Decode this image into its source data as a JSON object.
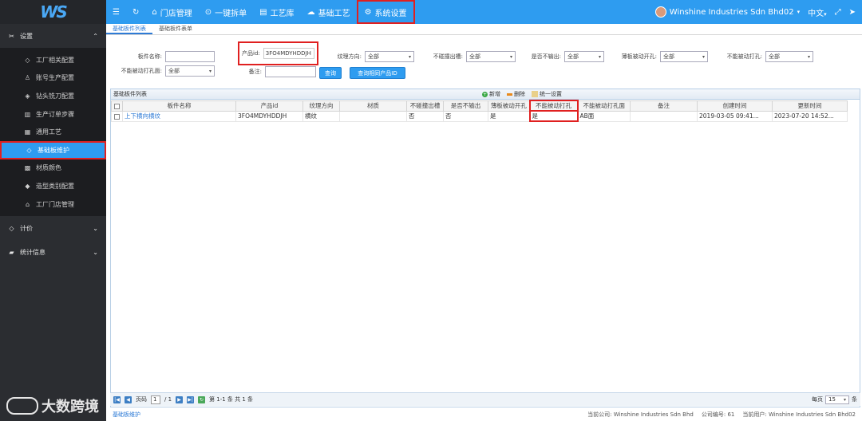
{
  "logo": {
    "text": "WS"
  },
  "topbar": {
    "items": [
      {
        "icon": "menu-icon",
        "glyph": "☰",
        "label": ""
      },
      {
        "icon": "refresh-icon",
        "glyph": "↻",
        "label": ""
      },
      {
        "icon": "store-icon",
        "glyph": "⌂",
        "label": "门店管理"
      },
      {
        "icon": "check-circle-icon",
        "glyph": "⊙",
        "label": "一键拆单"
      },
      {
        "icon": "list-icon",
        "glyph": "▤",
        "label": "工艺库"
      },
      {
        "icon": "cloud-icon",
        "glyph": "☁",
        "label": "基础工艺"
      },
      {
        "icon": "gear-icon",
        "glyph": "⚙",
        "label": "系统设置"
      }
    ],
    "company": "Winshine Industries Sdn Bhd02",
    "language": "中文",
    "expand_glyph": "⤢",
    "send_glyph": "➤"
  },
  "sidebar": {
    "group_settings": "设置",
    "items": [
      {
        "icon": "tag-icon",
        "glyph": "◇",
        "label": "工厂相关配置"
      },
      {
        "icon": "user-icon",
        "glyph": "♙",
        "label": "账号生产配置"
      },
      {
        "icon": "diamond-icon",
        "glyph": "◈",
        "label": "钻头铣刀配置"
      },
      {
        "icon": "order-icon",
        "glyph": "▥",
        "label": "生产订单步骤"
      },
      {
        "icon": "grid-icon",
        "glyph": "▦",
        "label": "通用工艺"
      },
      {
        "icon": "tag-icon",
        "glyph": "◇",
        "label": "基础板维护"
      },
      {
        "icon": "texture-icon",
        "glyph": "▩",
        "label": "材质颜色"
      },
      {
        "icon": "shape-icon",
        "glyph": "◆",
        "label": "造型类别配置"
      },
      {
        "icon": "home-icon",
        "glyph": "⌂",
        "label": "工厂门店管理"
      }
    ],
    "group_pricing": "计价",
    "group_stats": "统计信息"
  },
  "tabs": [
    {
      "label": "基础板件列表"
    },
    {
      "label": "基础板件表单"
    }
  ],
  "filters": {
    "board_name_label": "板件名称:",
    "board_name_value": "",
    "product_id_label": "产品id:",
    "product_id_value": "3FO4MDYHDDJH",
    "grain_label": "纹理方向:",
    "grain_value": "全部",
    "no_groove_label": "不碰撞出槽:",
    "no_groove_value": "全部",
    "no_output_label": "是否不输出:",
    "no_output_value": "全部",
    "thin_label": "薄板被动开孔:",
    "thin_value": "全部",
    "no_passive_label": "不能被动打孔:",
    "no_passive_value": "全部",
    "no_passive2_label": "不能被动打孔面:",
    "no_passive2_value": "全部",
    "remark_label": "备注:",
    "remark_value": "",
    "query_button": "查询",
    "query_related_button": "查询相同产品ID"
  },
  "grid": {
    "title": "基础板件列表",
    "add_label": "新增",
    "delete_label": "删除",
    "batch_label": "统一设置",
    "columns": [
      "板件名称",
      "产品id",
      "纹理方向",
      "材质",
      "不碰撞出槽",
      "是否不输出",
      "薄板被动开孔",
      "不能被动打孔",
      "不能被动打孔面",
      "备注",
      "创建时间",
      "更新时间"
    ],
    "rows": [
      [
        "上下横向横纹",
        "3FO4MDYHDDJH",
        "横纹",
        "",
        "否",
        "否",
        "是",
        "是",
        "AB面",
        "",
        "2019-03-05 09:41...",
        "2023-07-20 14:52..."
      ]
    ]
  },
  "pager": {
    "page_label": "页码",
    "page_value": "1",
    "total_pages": "/ 1",
    "range_text": "第 1-1 条  共 1 条",
    "per_page_label": "每页",
    "per_page_value": "15",
    "per_page_suffix": "条"
  },
  "status": {
    "left": "基础板维护",
    "company_label": "当前公司: Winshine Industries Sdn Bhd",
    "company_no": "公司编号: 61",
    "current_user": "当前用户: Winshine Industries Sdn Bhd02"
  },
  "watermark": {
    "text": "大数跨境"
  }
}
